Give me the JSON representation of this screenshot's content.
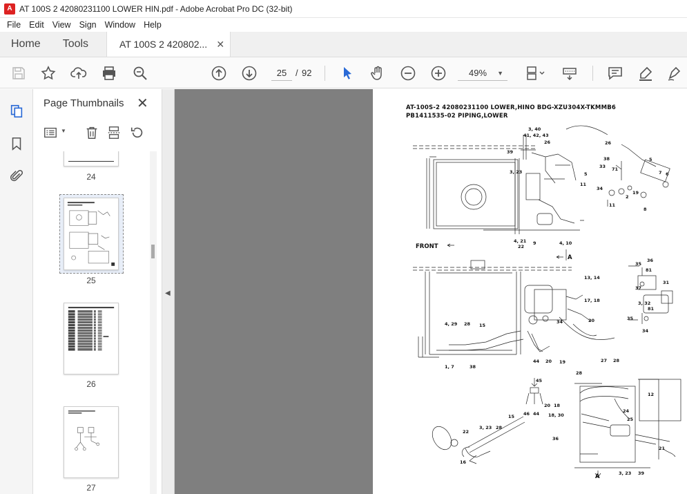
{
  "window": {
    "title": "AT 100S 2 42080231100 LOWER HIN.pdf - Adobe Acrobat Pro DC (32-bit)"
  },
  "menu": [
    "File",
    "Edit",
    "View",
    "Sign",
    "Window",
    "Help"
  ],
  "tabs": {
    "home": "Home",
    "tools": "Tools",
    "document": "AT 100S 2 420802..."
  },
  "toolbar": {
    "current_page": "25",
    "page_separator": "/",
    "total_pages": "92",
    "zoom": "49%"
  },
  "sidebar": {
    "title": "Page Thumbnails",
    "thumbnails": [
      {
        "label": "24"
      },
      {
        "label": "25"
      },
      {
        "label": "26"
      },
      {
        "label": "27"
      }
    ],
    "selected_page": "25"
  },
  "document_page": {
    "heading_line1": "AT-100S-2 42080231100 LOWER,HINO BDG-XZU304X-TKMMB6",
    "heading_line2": "PB1411535-02 PIPING,LOWER",
    "labels": {
      "front": "FRONT",
      "arrow_a_top": "A",
      "arrow_a_bottom": "A",
      "callouts": [
        "3, 40",
        "41, 42, 43",
        "26",
        "39",
        "5",
        "3, 23",
        "11",
        "9",
        "4, 21",
        "22",
        "4, 10",
        "26",
        "38",
        "71",
        "33",
        "34",
        "11",
        "2",
        "19",
        "8",
        "6",
        "7",
        "5",
        "13, 14",
        "17, 18",
        "20",
        "34",
        "4, 29",
        "28",
        "15",
        "1, 7",
        "38",
        "44",
        "20",
        "19",
        "35",
        "36",
        "31",
        "37",
        "3, 32",
        "81",
        "35",
        "34",
        "45",
        "20",
        "18",
        "44",
        "46",
        "18, 30",
        "27",
        "28",
        "28",
        "24",
        "25",
        "12",
        "36",
        "3, 23",
        "22",
        "28",
        "15",
        "16",
        "3, 23",
        "39",
        "21"
      ]
    }
  }
}
